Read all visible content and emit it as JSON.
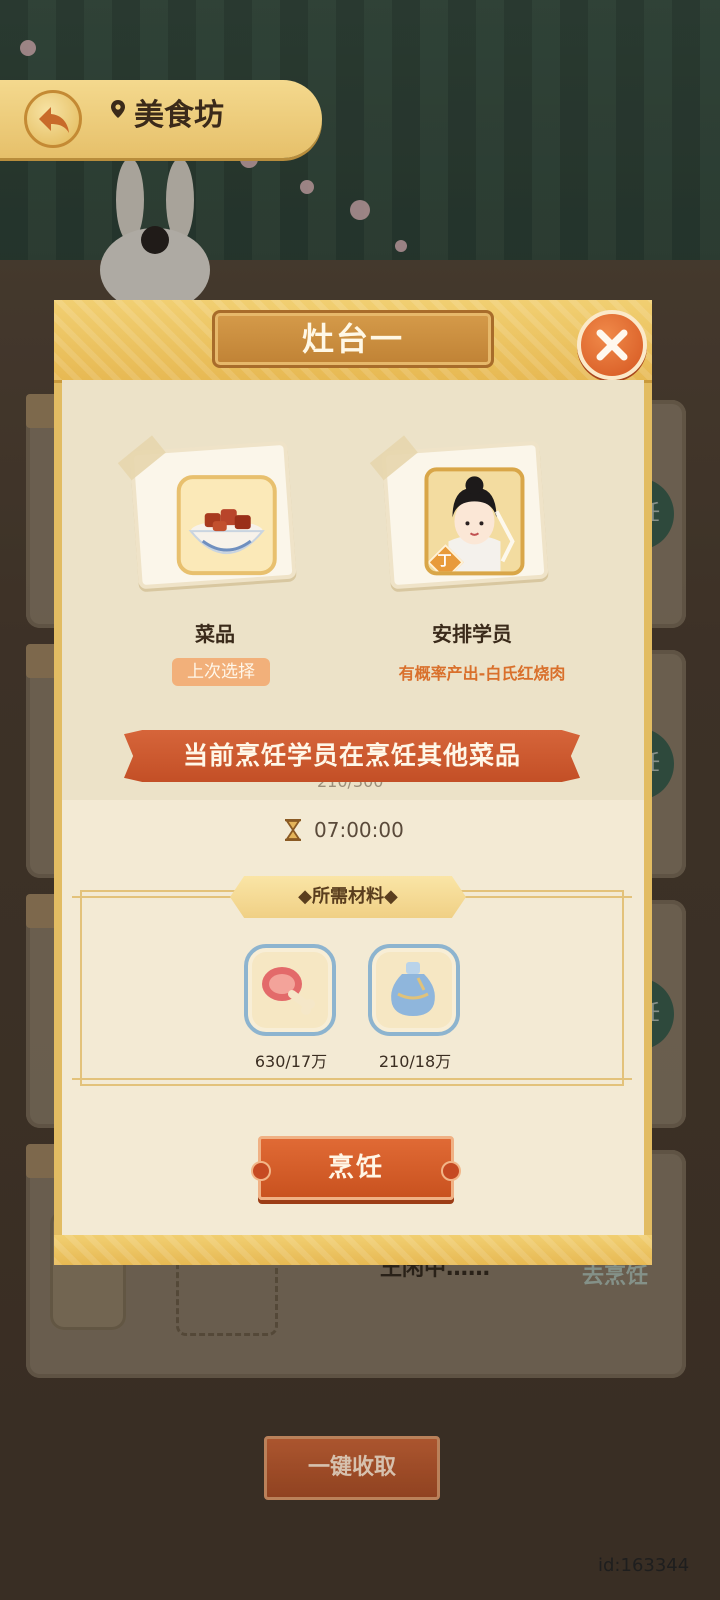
{
  "topbar": {
    "title": "美食坊"
  },
  "modal": {
    "title": "灶台一",
    "dish": {
      "label": "菜品",
      "badge": "上次选择"
    },
    "student": {
      "label": "安排学员",
      "rank": "丁",
      "probability_text": "有概率产出-白氏红烧肉"
    },
    "banner": "当前烹饪学员在烹饪其他菜品",
    "peek_progress": "210/300",
    "timer": "07:00:00",
    "materials": {
      "title": "◆所需材料◆",
      "items": [
        {
          "icon": "meat-drumstick-icon",
          "count": "630/17万"
        },
        {
          "icon": "sauce-vase-icon",
          "count": "210/18万"
        }
      ]
    },
    "cook_button": "烹饪"
  },
  "background": {
    "stove_label": "烹饪",
    "partial_text": "王闲中……",
    "partial_stove": "去烹饪"
  },
  "collect_button": "一键收取",
  "id_label": "id:163344"
}
